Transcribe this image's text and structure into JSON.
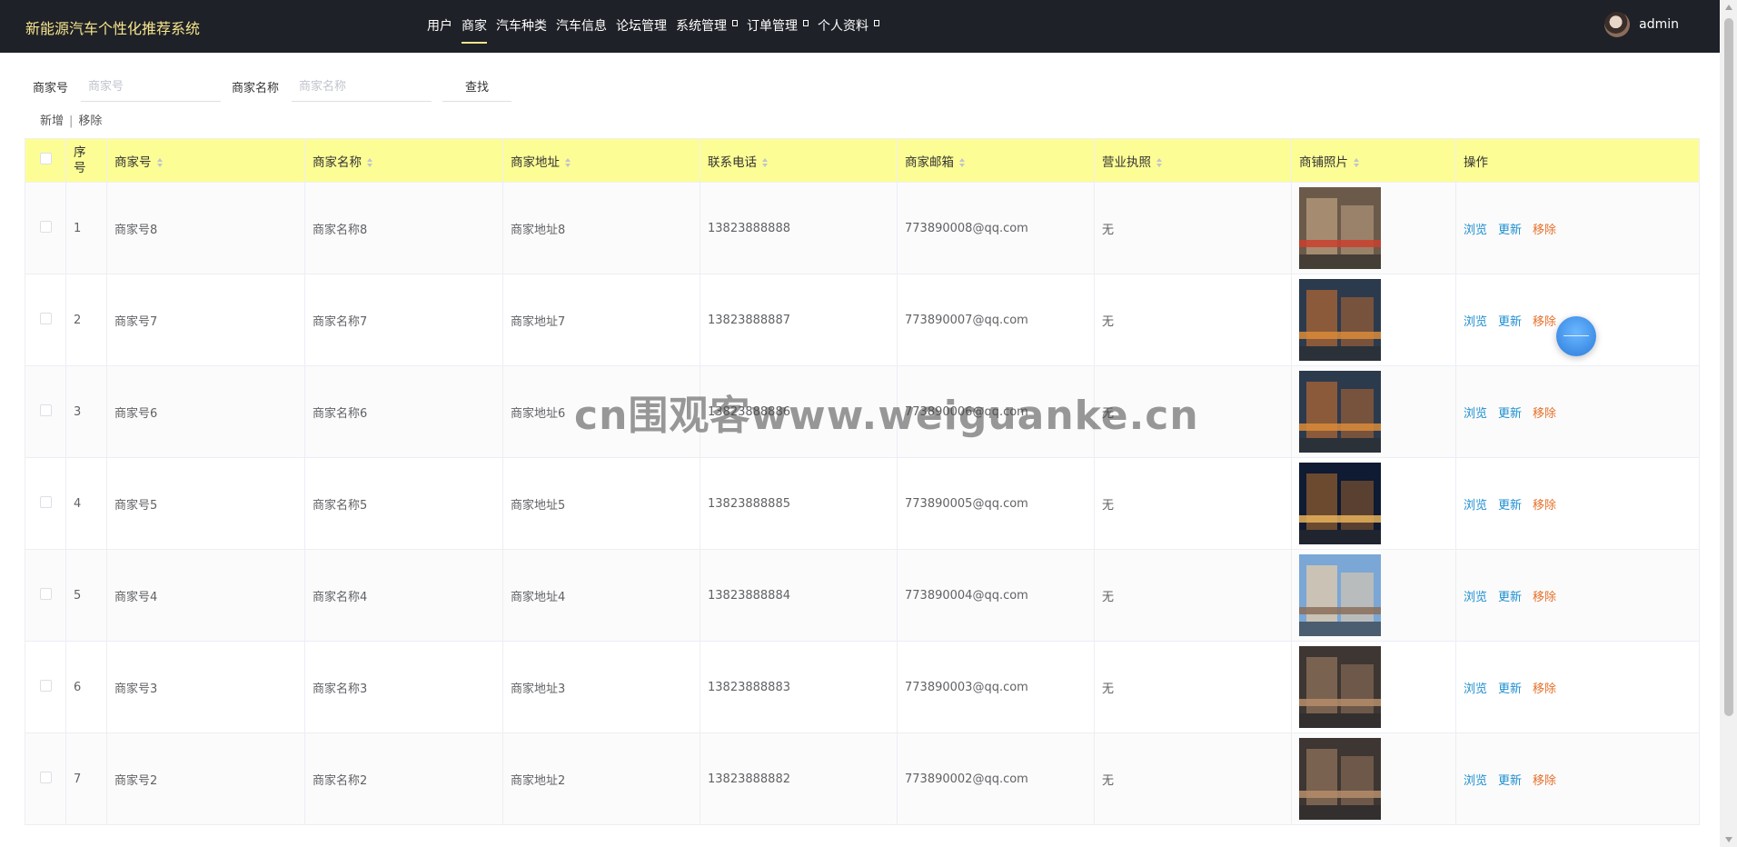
{
  "app": {
    "title": "新能源汽车个性化推荐系统"
  },
  "nav": [
    {
      "label": "用户",
      "dropdown": false,
      "active": false
    },
    {
      "label": "商家",
      "dropdown": false,
      "active": true
    },
    {
      "label": "汽车种类",
      "dropdown": false,
      "active": false
    },
    {
      "label": "汽车信息",
      "dropdown": false,
      "active": false
    },
    {
      "label": "论坛管理",
      "dropdown": false,
      "active": false
    },
    {
      "label": "系统管理",
      "dropdown": true,
      "active": false
    },
    {
      "label": "订单管理",
      "dropdown": true,
      "active": false
    },
    {
      "label": "个人资料",
      "dropdown": true,
      "active": false
    }
  ],
  "user": {
    "name": "admin"
  },
  "search": {
    "field1_label": "商家号",
    "field1_placeholder": "商家号",
    "field2_label": "商家名称",
    "field2_placeholder": "商家名称",
    "button": "查找"
  },
  "actions": {
    "add": "新增",
    "separator": "|",
    "remove": "移除"
  },
  "table": {
    "headers": {
      "index": "序号",
      "code": "商家号",
      "name": "商家名称",
      "address": "商家地址",
      "phone": "联系电话",
      "email": "商家邮箱",
      "license": "营业执照",
      "photo": "商铺照片",
      "ops": "操作"
    },
    "row_actions": {
      "view": "浏览",
      "update": "更新",
      "remove": "移除"
    },
    "rows": [
      {
        "index": "1",
        "code": "商家号8",
        "name": "商家名称8",
        "address": "商家地址8",
        "phone": "13823888888",
        "email": "773890008@qq.com",
        "license": "无"
      },
      {
        "index": "2",
        "code": "商家号7",
        "name": "商家名称7",
        "address": "商家地址7",
        "phone": "13823888887",
        "email": "773890007@qq.com",
        "license": "无"
      },
      {
        "index": "3",
        "code": "商家号6",
        "name": "商家名称6",
        "address": "商家地址6",
        "phone": "13823888886",
        "email": "773890006@qq.com",
        "license": "无"
      },
      {
        "index": "4",
        "code": "商家号5",
        "name": "商家名称5",
        "address": "商家地址5",
        "phone": "13823888885",
        "email": "773890005@qq.com",
        "license": "无"
      },
      {
        "index": "5",
        "code": "商家号4",
        "name": "商家名称4",
        "address": "商家地址4",
        "phone": "13823888884",
        "email": "773890004@qq.com",
        "license": "无"
      },
      {
        "index": "6",
        "code": "商家号3",
        "name": "商家名称3",
        "address": "商家地址3",
        "phone": "13823888883",
        "email": "773890003@qq.com",
        "license": "无"
      },
      {
        "index": "7",
        "code": "商家号2",
        "name": "商家名称2",
        "address": "商家地址2",
        "phone": "13823888882",
        "email": "773890002@qq.com",
        "license": "无"
      }
    ]
  },
  "watermark": "cn围观客www.weiguanke.cn",
  "colors": {
    "topbar": "#1e2127",
    "brand": "#f6e58d",
    "header_row": "#fdfd96",
    "link": "#1f8fd1",
    "danger": "#e6702a"
  }
}
